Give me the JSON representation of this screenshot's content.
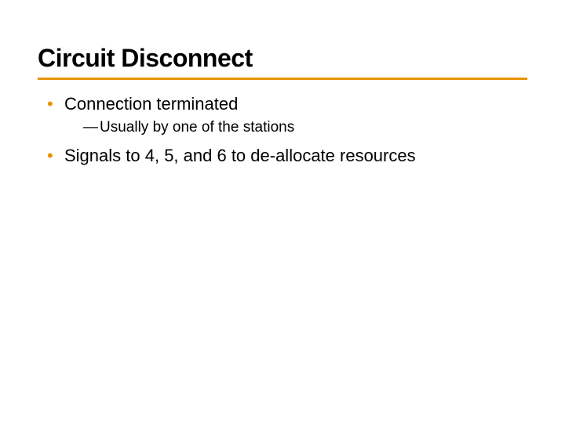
{
  "slide": {
    "title": "Circuit Disconnect",
    "bullets": [
      {
        "text": "Connection terminated",
        "sub": [
          {
            "dash": "—",
            "text": "Usually by one of the stations"
          }
        ]
      },
      {
        "text": "Signals to 4, 5, and 6 to de-allocate resources",
        "sub": []
      }
    ]
  }
}
